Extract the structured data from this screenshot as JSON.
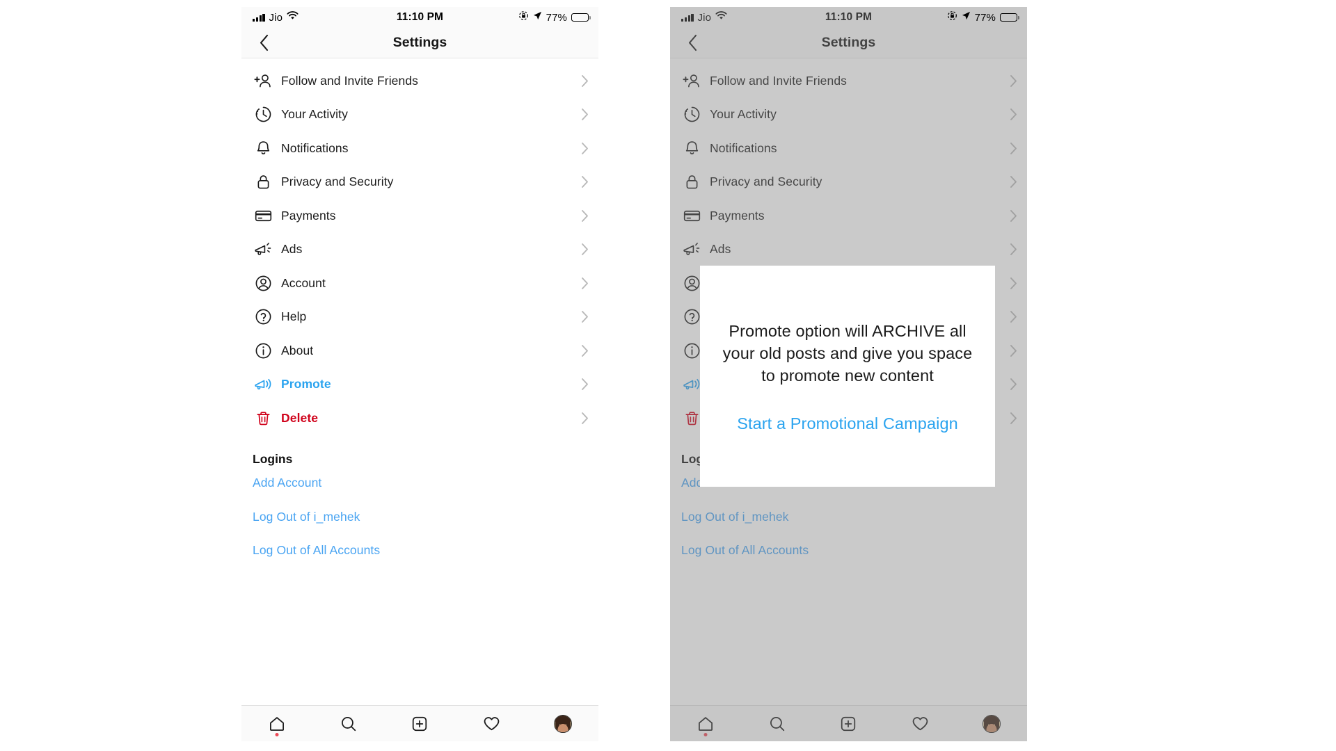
{
  "status_bar": {
    "carrier": "Jio",
    "time": "11:10 PM",
    "battery_percent": "77%",
    "icons": [
      "signal-bars-icon",
      "wifi-icon",
      "rotation-lock-icon",
      "location-arrow-icon",
      "battery-icon"
    ]
  },
  "nav": {
    "title": "Settings",
    "back_icon": "chevron-left-icon"
  },
  "settings_items": [
    {
      "label": "Follow and Invite Friends",
      "icon": "person-plus-icon",
      "style": "default"
    },
    {
      "label": "Your Activity",
      "icon": "activity-clock-icon",
      "style": "default"
    },
    {
      "label": "Notifications",
      "icon": "bell-icon",
      "style": "default"
    },
    {
      "label": "Privacy and Security",
      "icon": "lock-icon",
      "style": "default"
    },
    {
      "label": "Payments",
      "icon": "credit-card-icon",
      "style": "default"
    },
    {
      "label": "Ads",
      "icon": "megaphone-icon",
      "style": "default"
    },
    {
      "label": "Account",
      "icon": "account-circle-icon",
      "style": "default"
    },
    {
      "label": "Help",
      "icon": "question-circle-icon",
      "style": "default"
    },
    {
      "label": "About",
      "icon": "info-circle-icon",
      "style": "default"
    },
    {
      "label": "Promote",
      "icon": "megaphone-sound-icon",
      "style": "accent"
    },
    {
      "label": "Delete",
      "icon": "trash-icon",
      "style": "danger"
    }
  ],
  "logins": {
    "title": "Logins",
    "links": [
      "Add Account",
      "Log Out of i_mehek",
      "Log Out of All Accounts"
    ]
  },
  "tab_bar": {
    "tabs": [
      {
        "icon": "home-icon",
        "badge": true
      },
      {
        "icon": "search-icon",
        "badge": false
      },
      {
        "icon": "plus-box-icon",
        "badge": false
      },
      {
        "icon": "heart-icon",
        "badge": false
      },
      {
        "icon": "profile-avatar",
        "badge": false
      }
    ]
  },
  "modal": {
    "message": "Promote option will ARCHIVE all your old posts and give you space to promote new content",
    "cta": "Start a Promotional Campaign"
  },
  "colors": {
    "accent_blue": "#2aa3ef",
    "link_blue": "#49a4f2",
    "danger_red": "#d0021b",
    "badge_red": "#ed4956",
    "chevron_gray": "#b9b9b9",
    "dim_overlay": "#b4b4b4"
  }
}
